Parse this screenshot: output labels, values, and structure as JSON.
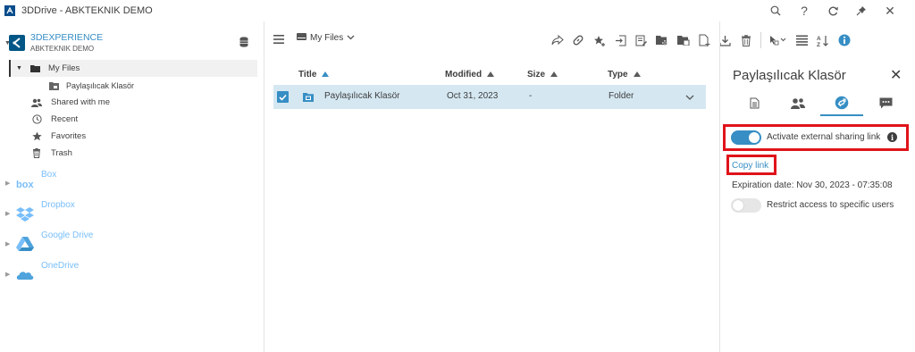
{
  "window": {
    "title": "3DDrive - ABKTEKNIK DEMO",
    "controls": [
      "search-icon",
      "help-icon",
      "refresh-icon",
      "pin-icon",
      "close-icon"
    ],
    "help_label": "?",
    "close_label": "✕"
  },
  "sidebar": {
    "account": {
      "name": "3DEXPERIENCE",
      "tenant": "ABKTEKNIK DEMO"
    },
    "tree": [
      {
        "label": "My Files",
        "icon": "folder-icon",
        "expanded": true,
        "selected": true
      },
      {
        "label": "Paylaşılıcak Klasör",
        "icon": "shared-folder-icon"
      },
      {
        "label": "Shared with me",
        "icon": "users-icon"
      },
      {
        "label": "Recent",
        "icon": "clock-icon"
      },
      {
        "label": "Favorites",
        "icon": "star-icon"
      },
      {
        "label": "Trash",
        "icon": "trash-icon"
      }
    ],
    "clouds": [
      {
        "name": "Box",
        "icon": "box-icon"
      },
      {
        "name": "Dropbox",
        "icon": "dropbox-icon"
      },
      {
        "name": "Google Drive",
        "icon": "google-drive-icon"
      },
      {
        "name": "OneDrive",
        "icon": "onedrive-icon"
      }
    ]
  },
  "toolbar": {
    "location_label": "My Files",
    "actions": [
      "share-icon",
      "link-icon",
      "favorite-add-icon",
      "move-icon",
      "edit-icon",
      "new-folder-icon",
      "copy-folder-icon",
      "new-file-icon",
      "download-icon",
      "delete-icon",
      "select-mode-icon",
      "list-view-icon",
      "sort-icon",
      "info-icon"
    ]
  },
  "table": {
    "columns": [
      "Title",
      "Modified",
      "Size",
      "Type"
    ],
    "rows": [
      {
        "title": "Paylaşılıcak Klasör",
        "modified": "Oct 31, 2023",
        "size": "-",
        "type": "Folder",
        "selected": true
      }
    ]
  },
  "panel": {
    "title": "Paylaşılıcak Klasör",
    "close_label": "✕",
    "tabs": [
      "properties-icon",
      "members-icon",
      "external-share-icon",
      "comments-icon"
    ],
    "active_tab": 2,
    "external_sharing_label": "Activate external sharing link",
    "external_sharing_on": true,
    "info_label": "i",
    "copy_link_label": "Copy link",
    "expiration": "Expiration date: Nov 30, 2023 - 07:35:08",
    "restrict_label": "Restrict access to specific users",
    "restrict_on": false
  },
  "colors": {
    "accent": "#368ec4",
    "selection_row": "#d5e8f2",
    "highlight_box": "#e0131a",
    "cloud_label": "#78befa"
  }
}
